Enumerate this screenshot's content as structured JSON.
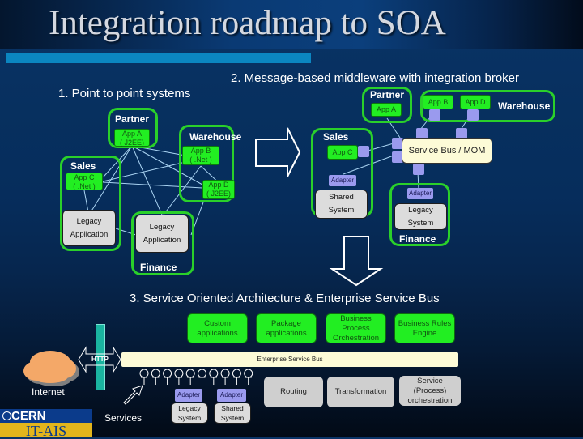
{
  "title": "Integration roadmap to SOA",
  "colors": {
    "background": "#062d5c",
    "accent_bar": "#0b86c1",
    "group_border": "#2ad02a",
    "app_fill": "#22ee22",
    "adapter_fill": "#9a9aee",
    "bus_fill": "#fdfbd7",
    "legacy_fill": "#dcdcdc",
    "http_bar": "#1ab4a0",
    "cloud": "#f4a868"
  },
  "section1": {
    "heading": "1. Point to point systems",
    "groups": {
      "partner": "Partner",
      "warehouse": "Warehouse",
      "sales": "Sales",
      "finance": "Finance"
    },
    "apps": {
      "app_a": [
        "App A",
        "( J2EE)"
      ],
      "app_b": [
        "App B",
        "( .Net )"
      ],
      "app_c": [
        "App C",
        "( .Net )"
      ],
      "app_d": [
        "App D",
        "( J2EE)"
      ]
    },
    "legacy_sales": [
      "Legacy",
      "Application"
    ],
    "legacy_finance": [
      "Legacy",
      "Application"
    ]
  },
  "section2": {
    "heading": "2. Message-based middleware with integration broker",
    "groups": {
      "partner": "Partner",
      "warehouse": "Warehouse",
      "sales": "Sales",
      "finance": "Finance"
    },
    "apps": {
      "app_a": "App A",
      "app_b": "App B",
      "app_c": "App C",
      "app_d": "App D"
    },
    "bus_label": "Service Bus / MOM",
    "adapter_label": "Adapter",
    "shared_system": [
      "Shared",
      "System"
    ],
    "legacy_system": [
      "Legacy",
      "System"
    ]
  },
  "section3": {
    "heading": "3. Service Oriented Architecture & Enterprise Service Bus",
    "top_boxes": [
      [
        "Custom",
        "applications"
      ],
      [
        "Package",
        "applications"
      ],
      [
        "Business",
        "Process",
        "Orchestration"
      ],
      [
        "Business Rules",
        "Engine"
      ]
    ],
    "http_label": "HTTP",
    "esb_label": "Enterprise Service Bus",
    "internet_label": "Internet",
    "services_label": "Services",
    "service_count": 10,
    "adapter_label": "Adapter",
    "legacy_system": [
      "Legacy",
      "System"
    ],
    "shared_system": [
      "Shared",
      "System"
    ],
    "bottom_boxes": [
      [
        "Routing"
      ],
      [
        "Transformation"
      ],
      [
        "Service",
        "(Process)",
        "orchestration"
      ]
    ]
  },
  "footer": {
    "logo_top": "CERN",
    "logo_bottom": "IT-AIS"
  }
}
